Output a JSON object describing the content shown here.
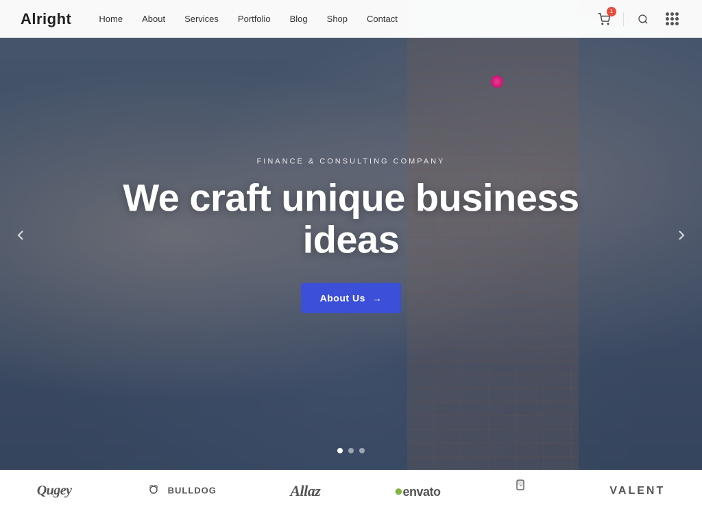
{
  "brand": {
    "name": "Alright"
  },
  "navbar": {
    "links": [
      {
        "label": "Home",
        "href": "#"
      },
      {
        "label": "About",
        "href": "#"
      },
      {
        "label": "Services",
        "href": "#"
      },
      {
        "label": "Portfolio",
        "href": "#"
      },
      {
        "label": "Blog",
        "href": "#"
      },
      {
        "label": "Shop",
        "href": "#"
      },
      {
        "label": "Contact",
        "href": "#"
      }
    ],
    "cart_count": "1"
  },
  "hero": {
    "subtitle": "Finance & Consulting Company",
    "title": "We craft unique business ideas",
    "cta_label": "About Us",
    "cta_arrow": "→",
    "dots": [
      {
        "active": true
      },
      {
        "active": false
      },
      {
        "active": false
      }
    ]
  },
  "logos": [
    {
      "name": "Qugey",
      "style": "serif"
    },
    {
      "name": "🐾 BULLDOG",
      "style": "sans"
    },
    {
      "name": "Allaz",
      "style": "italic"
    },
    {
      "name": "●envato",
      "style": "sans"
    },
    {
      "name": "⬡",
      "style": "sans"
    },
    {
      "name": "VALENT",
      "style": "sans"
    }
  ],
  "icons": {
    "cart": "🛒",
    "search": "🔍",
    "grid": "⋮⋮⋮",
    "arrow_left": "‹",
    "arrow_right": "›"
  }
}
